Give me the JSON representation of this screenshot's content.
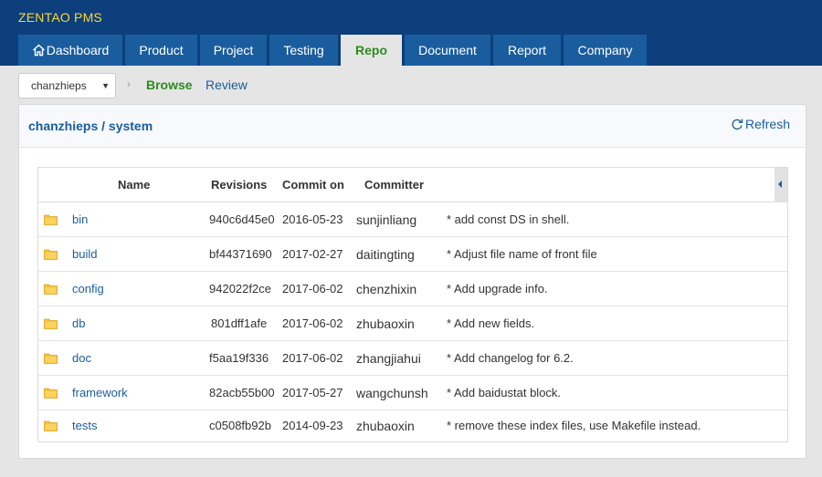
{
  "app": {
    "brand": "ZENTAO PMS"
  },
  "nav": [
    {
      "label": "Dashboard",
      "icon": "home-icon",
      "active": false
    },
    {
      "label": "Product",
      "active": false
    },
    {
      "label": "Project",
      "active": false
    },
    {
      "label": "Testing",
      "active": false
    },
    {
      "label": "Repo",
      "active": true
    },
    {
      "label": "Document",
      "active": false
    },
    {
      "label": "Report",
      "active": false
    },
    {
      "label": "Company",
      "active": false
    }
  ],
  "subnav": {
    "repo_select": "chanzhieps",
    "browse": "Browse",
    "review": "Review"
  },
  "panel": {
    "title": "chanzhieps / system",
    "refresh": "Refresh"
  },
  "table": {
    "headers": {
      "name": "Name",
      "revisions": "Revisions",
      "commit_on": "Commit on",
      "committer": "Committer"
    },
    "rows": [
      {
        "name": "bin",
        "rev": "940c6d45e0",
        "date": "2016-05-23",
        "committer": "sunjinliang",
        "comment": "* add const DS in shell."
      },
      {
        "name": "build",
        "rev": "bf44371690",
        "date": "2017-02-27",
        "committer": "daitingting",
        "comment": "* Adjust file name of front file"
      },
      {
        "name": "config",
        "rev": "942022f2ce",
        "date": "2017-06-02",
        "committer": "chenzhixin",
        "comment": "* Add upgrade info."
      },
      {
        "name": "db",
        "rev": "801dff1afe",
        "date": "2017-06-02",
        "committer": "zhubaoxin",
        "comment": "* Add new fields."
      },
      {
        "name": "doc",
        "rev": "f5aa19f336",
        "date": "2017-06-02",
        "committer": "zhangjiahui",
        "comment": "* Add changelog for 6.2."
      },
      {
        "name": "framework",
        "rev": "82acb55b00",
        "date": "2017-05-27",
        "committer": "wangchunsh",
        "comment": "* Add baidustat block."
      },
      {
        "name": "tests",
        "rev": "c0508fb92b",
        "date": "2014-09-23",
        "committer": "zhubaoxin",
        "comment": "* remove these index files, use Makefile instead."
      }
    ]
  },
  "colors": {
    "header_bg": "#0c3f7b",
    "nav_bg": "#1a5d9e",
    "brand": "#ffd633",
    "active_green": "#2e8b1f",
    "link_blue": "#1a5d9e",
    "folder": "#f5c242"
  }
}
